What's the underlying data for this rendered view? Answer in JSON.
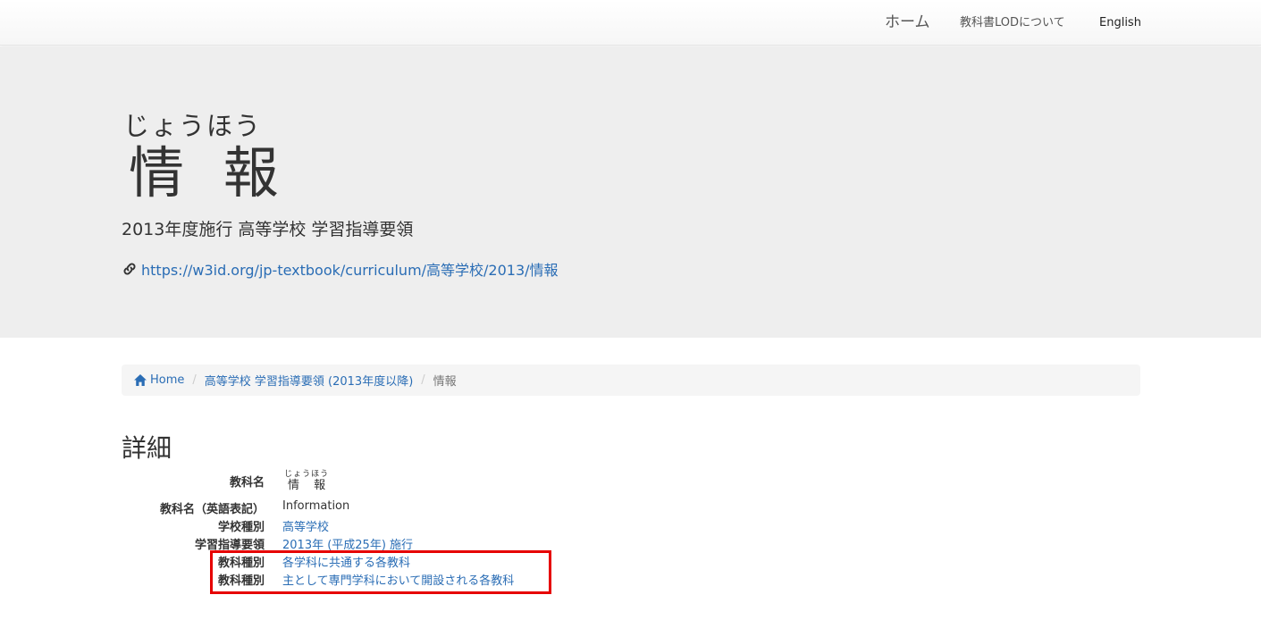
{
  "nav": {
    "home": "ホーム",
    "about": "教科書LODについて",
    "english": "English"
  },
  "jumbotron": {
    "reading": "じょうほう",
    "title": "情 報",
    "subtitle": "2013年度施行 高等学校 学習指導要領",
    "uri": "https://w3id.org/jp-textbook/curriculum/高等学校/2013/情報"
  },
  "breadcrumb": {
    "home": "Home",
    "curriculum": "高等学校 学習指導要領 (2013年度以降)",
    "current": "情報"
  },
  "details": {
    "heading": "詳細",
    "rows": [
      {
        "label": "教科名",
        "reading": "じょうほう",
        "value": "情 報"
      },
      {
        "label": "教科名（英語表記）",
        "value": "Information"
      },
      {
        "label": "学校種別",
        "value": "高等学校"
      },
      {
        "label": "学習指導要領",
        "value": "2013年 (平成25年) 施行"
      },
      {
        "label": "教科種別",
        "value": "各学科に共通する各教科"
      },
      {
        "label": "教科種別",
        "value": "主として専門学科において開設される各教科"
      }
    ]
  },
  "colors": {
    "link": "#2a6db5",
    "jumbotron_bg": "#eeeeee",
    "highlight": "#e60000"
  },
  "icons": [
    "link-icon",
    "home-icon"
  ]
}
